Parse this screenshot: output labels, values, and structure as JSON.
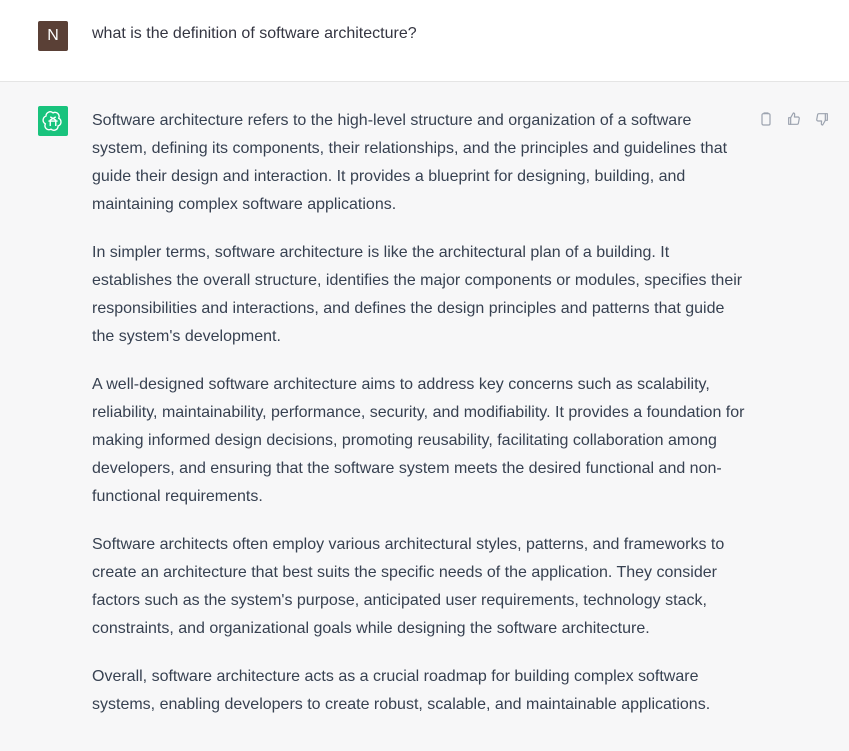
{
  "user": {
    "avatar_initial": "N",
    "message": "what is the definition of software architecture?"
  },
  "assistant": {
    "avatar_icon": "openai-logo-icon",
    "paragraphs": [
      "Software architecture refers to the high-level structure and organization of a software system, defining its components, their relationships, and the principles and guidelines that guide their design and interaction. It provides a blueprint for designing, building, and maintaining complex software applications.",
      "In simpler terms, software architecture is like the architectural plan of a building. It establishes the overall structure, identifies the major components or modules, specifies their responsibilities and interactions, and defines the design principles and patterns that guide the system's development.",
      "A well-designed software architecture aims to address key concerns such as scalability, reliability, maintainability, performance, security, and modifiability. It provides a foundation for making informed design decisions, promoting reusability, facilitating collaboration among developers, and ensuring that the software system meets the desired functional and non-functional requirements.",
      "Software architects often employ various architectural styles, patterns, and frameworks to create an architecture that best suits the specific needs of the application. They consider factors such as the system's purpose, anticipated user requirements, technology stack, constraints, and organizational goals while designing the software architecture.",
      "Overall, software architecture acts as a crucial roadmap for building complex software systems, enabling developers to create robust, scalable, and maintainable applications."
    ],
    "actions": [
      "clipboard-icon",
      "thumbs-up-icon",
      "thumbs-down-icon"
    ]
  },
  "colors": {
    "user_avatar": "#5a4036",
    "assistant_avatar": "#19c37d",
    "assistant_bg": "#f7f7f8",
    "user_bg": "#ffffff"
  }
}
